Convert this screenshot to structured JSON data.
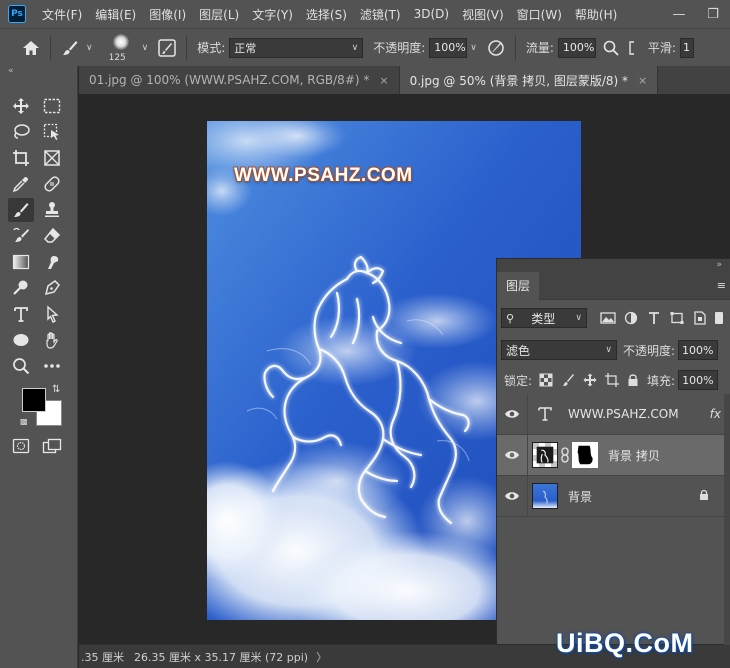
{
  "app": {
    "logo": "Ps"
  },
  "menu": [
    "文件(F)",
    "编辑(E)",
    "图像(I)",
    "图层(L)",
    "文字(Y)",
    "选择(S)",
    "滤镜(T)",
    "3D(D)",
    "视图(V)",
    "窗口(W)",
    "帮助(H)"
  ],
  "window_controls": {
    "minimize": "—",
    "restore": "❐"
  },
  "options": {
    "brush_size": "125",
    "mode_label": "模式:",
    "mode_value": "正常",
    "opacity_label": "不透明度:",
    "opacity_value": "100%",
    "flow_label": "流量:",
    "flow_value": "100%",
    "smoothing_label": "平滑:",
    "smoothing_value": "1"
  },
  "tabs": [
    {
      "label": "01.jpg @ 100% (WWW.PSAHZ.COM, RGB/8#) *",
      "close": "×"
    },
    {
      "label": "0.jpg @ 50% (背景 拷贝, 图层蒙版/8) *",
      "close": "×"
    }
  ],
  "canvas": {
    "watermark": "WWW.PSAHZ.COM"
  },
  "status": {
    "zoom": ".35 厘米",
    "info": "26.35 厘米 x 35.17 厘米 (72 ppi)",
    "arrow": "〉"
  },
  "layers_panel": {
    "tab_label": "图层",
    "filter_kind": "类型",
    "blend_mode": "滤色",
    "opacity_label": "不透明度:",
    "opacity_value": "100%",
    "lock_label": "锁定:",
    "fill_label": "填充:",
    "fill_value": "100%",
    "layers": [
      {
        "name": "WWW.PSAHZ.COM",
        "type": "text",
        "fx": "fx"
      },
      {
        "name": "背景 拷贝",
        "type": "masked",
        "selected": true
      },
      {
        "name": "背景",
        "type": "background",
        "locked": true
      }
    ]
  },
  "site_watermark": "UiBQ.CoM",
  "colors": {
    "foreground": "#000000",
    "background": "#ffffff",
    "ui_dark": "#282828",
    "ui_panel": "#535353"
  }
}
